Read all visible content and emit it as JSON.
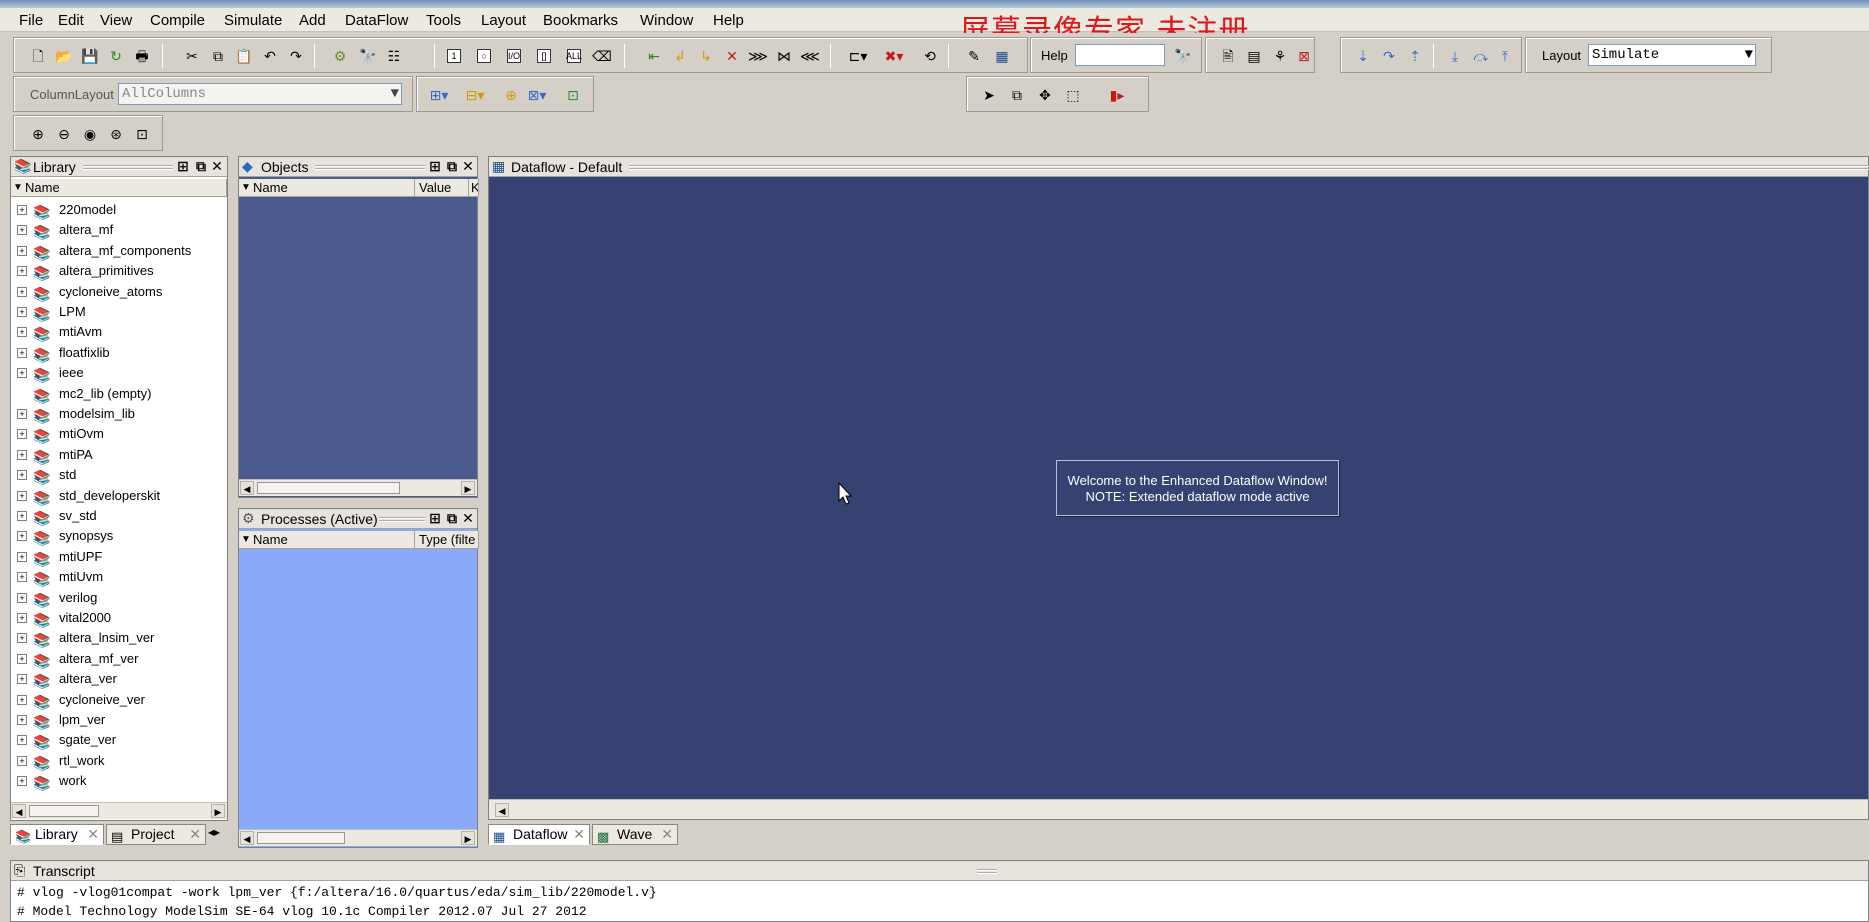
{
  "menubar": {
    "items": [
      "File",
      "Edit",
      "View",
      "Compile",
      "Simulate",
      "Add",
      "DataFlow",
      "Tools",
      "Layout",
      "Bookmarks",
      "Window",
      "Help"
    ]
  },
  "watermark": "屏幕录像专家 未注册",
  "toolbar": {
    "help_label": "Help",
    "help_value": "",
    "layout_label": "Layout",
    "layout_value": "Simulate",
    "column_layout_label": "ColumnLayout",
    "column_layout_value": "AllColumns"
  },
  "library": {
    "title": "Library",
    "col_name": "Name",
    "items": [
      {
        "name": "220model",
        "expandable": true
      },
      {
        "name": "altera_mf",
        "expandable": true
      },
      {
        "name": "altera_mf_components",
        "expandable": true
      },
      {
        "name": "altera_primitives",
        "expandable": true
      },
      {
        "name": "cycloneive_atoms",
        "expandable": true
      },
      {
        "name": "LPM",
        "expandable": true
      },
      {
        "name": "mtiAvm",
        "expandable": true
      },
      {
        "name": "floatfixlib",
        "expandable": true
      },
      {
        "name": "ieee",
        "expandable": true
      },
      {
        "name": "mc2_lib  (empty)",
        "expandable": false
      },
      {
        "name": "modelsim_lib",
        "expandable": true
      },
      {
        "name": "mtiOvm",
        "expandable": true
      },
      {
        "name": "mtiPA",
        "expandable": true
      },
      {
        "name": "std",
        "expandable": true
      },
      {
        "name": "std_developerskit",
        "expandable": true
      },
      {
        "name": "sv_std",
        "expandable": true
      },
      {
        "name": "synopsys",
        "expandable": true
      },
      {
        "name": "mtiUPF",
        "expandable": true
      },
      {
        "name": "mtiUvm",
        "expandable": true
      },
      {
        "name": "verilog",
        "expandable": true
      },
      {
        "name": "vital2000",
        "expandable": true
      },
      {
        "name": "altera_lnsim_ver",
        "expandable": true
      },
      {
        "name": "altera_mf_ver",
        "expandable": true
      },
      {
        "name": "altera_ver",
        "expandable": true
      },
      {
        "name": "cycloneive_ver",
        "expandable": true
      },
      {
        "name": "lpm_ver",
        "expandable": true
      },
      {
        "name": "sgate_ver",
        "expandable": true
      },
      {
        "name": "rtl_work",
        "expandable": true
      },
      {
        "name": "work",
        "expandable": true
      }
    ],
    "tabs": [
      "Library",
      "Project"
    ]
  },
  "objects": {
    "title": "Objects",
    "cols": [
      "Name",
      "Value",
      "K"
    ]
  },
  "processes": {
    "title": "Processes (Active)",
    "cols": [
      "Name",
      "Type (filte"
    ]
  },
  "dataflow": {
    "title": "Dataflow - Default",
    "welcome_line1": "Welcome to the Enhanced Dataflow Window!",
    "welcome_line2": "NOTE: Extended dataflow mode active",
    "tabs": [
      "Dataflow",
      "Wave"
    ]
  },
  "transcript": {
    "title": "Transcript",
    "lines": [
      "# vlog -vlog01compat -work lpm_ver {f:/altera/16.0/quartus/eda/sim_lib/220model.v}",
      "# Model Technology ModelSim SE-64 vlog 10.1c Compiler 2012.07 Jul 27 2012"
    ]
  },
  "colors": {
    "dataflow_bg": "#354272",
    "objects_bg": "#4a5a8f",
    "processes_bg": "#8aaaf8",
    "watermark": "#e0161b"
  }
}
